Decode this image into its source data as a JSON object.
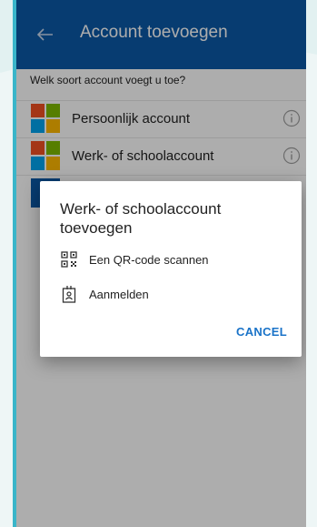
{
  "appbar": {
    "title": "Account toevoegen",
    "back_icon": "arrow-left-icon"
  },
  "question": "Welk soort account voegt u toe?",
  "accounts": [
    {
      "label": "Persoonlijk account",
      "icon": "microsoft-logo-icon",
      "info_icon": "info-icon"
    },
    {
      "label": "Werk- of schoolaccount",
      "icon": "microsoft-logo-icon",
      "info_icon": "info-icon"
    }
  ],
  "dialog": {
    "title": "Werk- of schoolaccount toevoegen",
    "options": [
      {
        "label": "Een QR-code scannen",
        "icon": "qr-code-icon"
      },
      {
        "label": "Aanmelden",
        "icon": "badge-icon"
      }
    ],
    "cancel_label": "CANCEL"
  },
  "colors": {
    "appbar": "#0b59a7",
    "frame": "#3ab5c9",
    "accent": "#1a73c8",
    "ms_red": "#f25022",
    "ms_green": "#7fba00",
    "ms_blue": "#00a4ef",
    "ms_yellow": "#ffb900"
  }
}
